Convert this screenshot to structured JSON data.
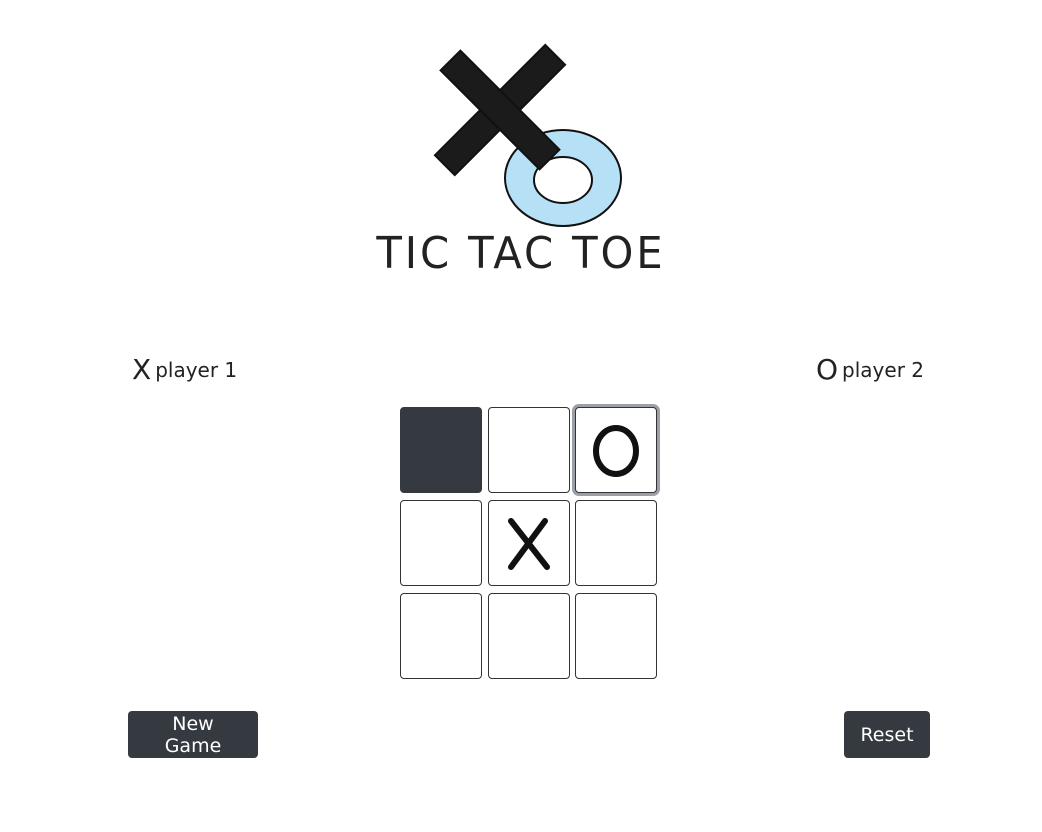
{
  "header": {
    "title": "TIC TAC TOE"
  },
  "players": [
    {
      "mark": "X",
      "label": "player 1"
    },
    {
      "mark": "O",
      "label": "player 2"
    }
  ],
  "board": {
    "cells": [
      "",
      "",
      "O",
      "",
      "X",
      "",
      "",
      "",
      ""
    ],
    "highlighted_cell": 0,
    "focused_cell": 2
  },
  "buttons": {
    "new_game": "New Game",
    "reset": "Reset"
  },
  "colors": {
    "button_bg": "#343a40",
    "logo_o": "#a6d8f0",
    "ink": "#1a1a1a"
  }
}
